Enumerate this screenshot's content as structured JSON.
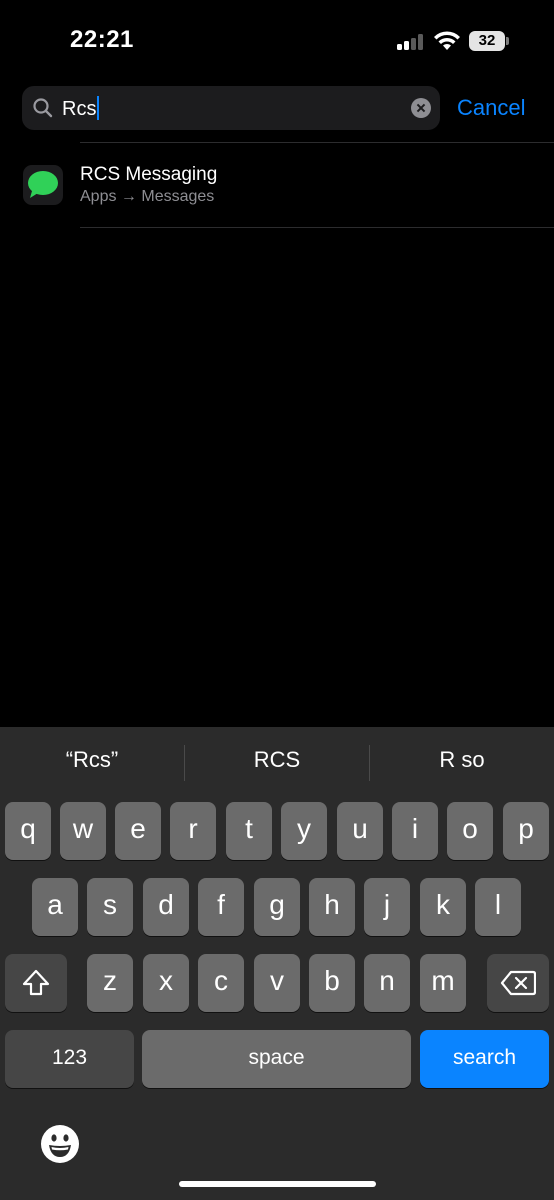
{
  "status_bar": {
    "time": "22:21",
    "battery_percent": "32",
    "signal_bars_active": 2
  },
  "search": {
    "query": "Rcs",
    "cancel_label": "Cancel",
    "icon": "magnifying-glass-icon",
    "clear_icon": "clear-x-icon"
  },
  "results": [
    {
      "title": "RCS Messaging",
      "path": "Apps → Messages",
      "icon": "messages-icon",
      "icon_color": "#30d158"
    }
  ],
  "keyboard": {
    "suggestions": [
      "“Rcs”",
      "RCS",
      "R so"
    ],
    "row1": [
      "q",
      "w",
      "e",
      "r",
      "t",
      "y",
      "u",
      "i",
      "o",
      "p"
    ],
    "row2": [
      "a",
      "s",
      "d",
      "f",
      "g",
      "h",
      "j",
      "k",
      "l"
    ],
    "row3": [
      "z",
      "x",
      "c",
      "v",
      "b",
      "n",
      "m"
    ],
    "numbers_label": "123",
    "space_label": "space",
    "return_label": "search",
    "shift_icon": "shift-icon",
    "delete_icon": "backspace-icon",
    "emoji_icon": "emoji-icon"
  },
  "colors": {
    "accent": "#0a84ff",
    "background": "#000000",
    "key": "#6b6b6b"
  }
}
